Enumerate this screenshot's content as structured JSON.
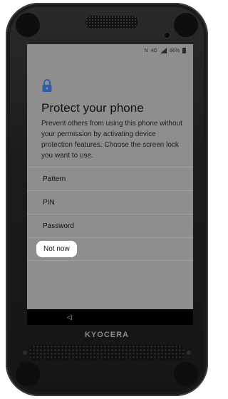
{
  "status_bar": {
    "nfc_icon": "nfc-icon",
    "network_label": "4G",
    "signal_icon": "signal-icon",
    "battery_percent": "86%"
  },
  "setup": {
    "icon": "lock-icon",
    "title": "Protect your phone",
    "description": "Prevent others from using this phone without your permission by activating device protection features. Choose the screen lock you want to use.",
    "options": [
      {
        "label": "Pattern"
      },
      {
        "label": "PIN"
      },
      {
        "label": "Password"
      },
      {
        "label": "Not now",
        "highlighted": true
      }
    ]
  },
  "nav": {
    "back_icon": "back-triangle-icon"
  },
  "device": {
    "brand": "KYOCERA"
  },
  "colors": {
    "screen_bg": "#8e8e8e",
    "lock_icon": "#2f5da8",
    "highlight": "#ffffff"
  }
}
